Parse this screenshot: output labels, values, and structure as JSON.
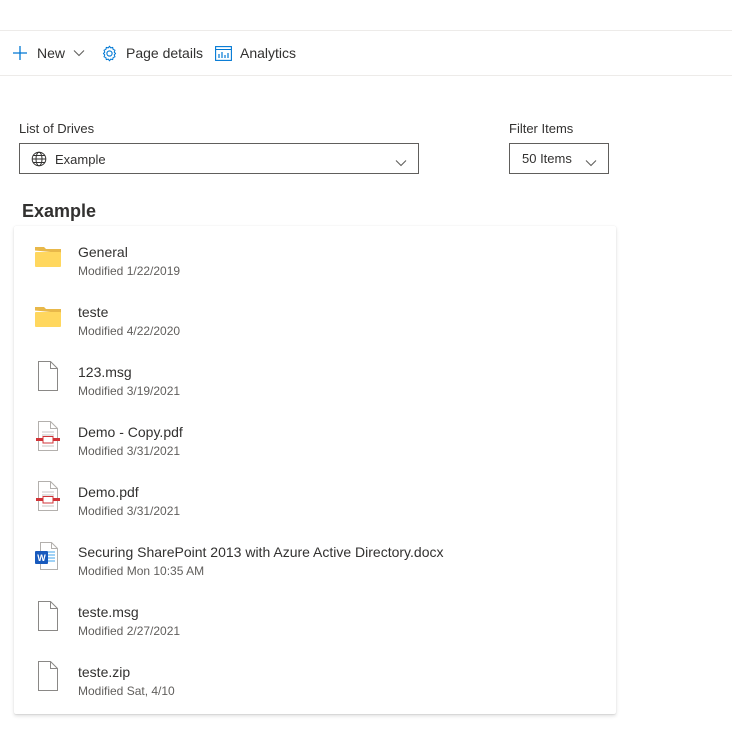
{
  "commandbar": {
    "new_label": "New",
    "page_details_label": "Page details",
    "analytics_label": "Analytics"
  },
  "drives": {
    "label": "List of Drives",
    "selected": "Example",
    "icon": "globe-icon"
  },
  "filter": {
    "label": "Filter Items",
    "selected": "50 Items"
  },
  "section": {
    "title": "Example"
  },
  "items": [
    {
      "name": "General",
      "modified": "Modified 1/22/2019",
      "icon": "folder-icon"
    },
    {
      "name": "teste",
      "modified": "Modified 4/22/2020",
      "icon": "folder-icon"
    },
    {
      "name": "123.msg",
      "modified": "Modified 3/19/2021",
      "icon": "file-icon"
    },
    {
      "name": "Demo - Copy.pdf",
      "modified": "Modified 3/31/2021",
      "icon": "pdf-icon"
    },
    {
      "name": "Demo.pdf",
      "modified": "Modified 3/31/2021",
      "icon": "pdf-icon"
    },
    {
      "name": "Securing SharePoint 2013 with Azure Active Directory.docx",
      "modified": "Modified Mon 10:35 AM",
      "icon": "word-doc-icon"
    },
    {
      "name": "teste.msg",
      "modified": "Modified 2/27/2021",
      "icon": "file-icon"
    },
    {
      "name": "teste.zip",
      "modified": "Modified Sat, 4/10",
      "icon": "file-icon"
    }
  ],
  "colors": {
    "accent": "#0078d4",
    "folder": "#ffd75e",
    "pdf_red": "#d13438",
    "word_blue": "#185abd"
  }
}
